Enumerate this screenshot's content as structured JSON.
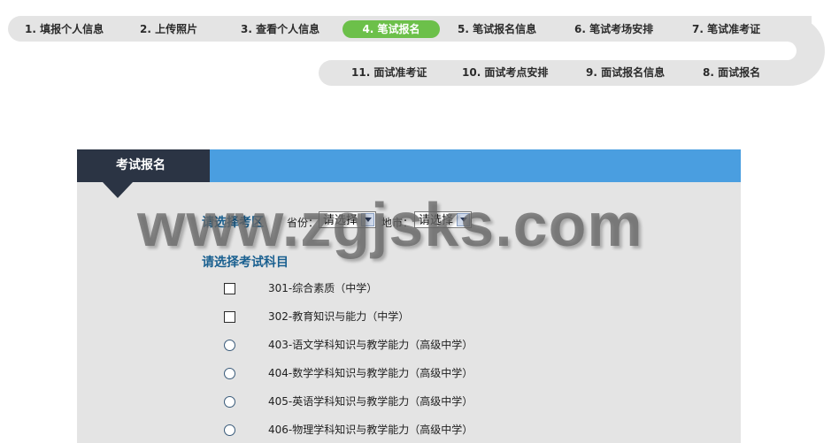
{
  "steps_top": [
    {
      "label": "1. 填报个人信息",
      "active": false
    },
    {
      "label": "2. 上传照片",
      "active": false
    },
    {
      "label": "3. 查看个人信息",
      "active": false
    },
    {
      "label": "4. 笔试报名",
      "active": true
    },
    {
      "label": "5. 笔试报名信息",
      "active": false
    },
    {
      "label": "6. 笔试考场安排",
      "active": false
    },
    {
      "label": "7. 笔试准考证",
      "active": false
    }
  ],
  "steps_bottom": [
    {
      "label": "11. 面试准考证"
    },
    {
      "label": "10. 面试考点安排"
    },
    {
      "label": "9. 面试报名信息"
    },
    {
      "label": "8. 面试报名"
    }
  ],
  "panel": {
    "title": "考试报名",
    "region_label": "请选择考区",
    "province_label": "省份：",
    "province_value": "请选择",
    "city_label": "地市：",
    "city_value": "请选择",
    "subject_label": "请选择考试科目"
  },
  "subjects": [
    {
      "label": "301-综合素质（中学）",
      "control": "checkbox"
    },
    {
      "label": "302-教育知识与能力（中学）",
      "control": "checkbox"
    },
    {
      "label": "403-语文学科知识与教学能力（高级中学）",
      "control": "radio"
    },
    {
      "label": "404-数学学科知识与教学能力（高级中学）",
      "control": "radio"
    },
    {
      "label": "405-英语学科知识与教学能力（高级中学）",
      "control": "radio"
    },
    {
      "label": "406-物理学科知识与教学能力（高级中学）",
      "control": "radio"
    }
  ],
  "watermark": "www.zgjsks.com",
  "colors": {
    "accent_green": "#6cc04a",
    "header_blue": "#4a9ee0",
    "tab_dark": "#2b3444",
    "track_gray": "#e4e4e4",
    "label_blue": "#1a6090"
  }
}
